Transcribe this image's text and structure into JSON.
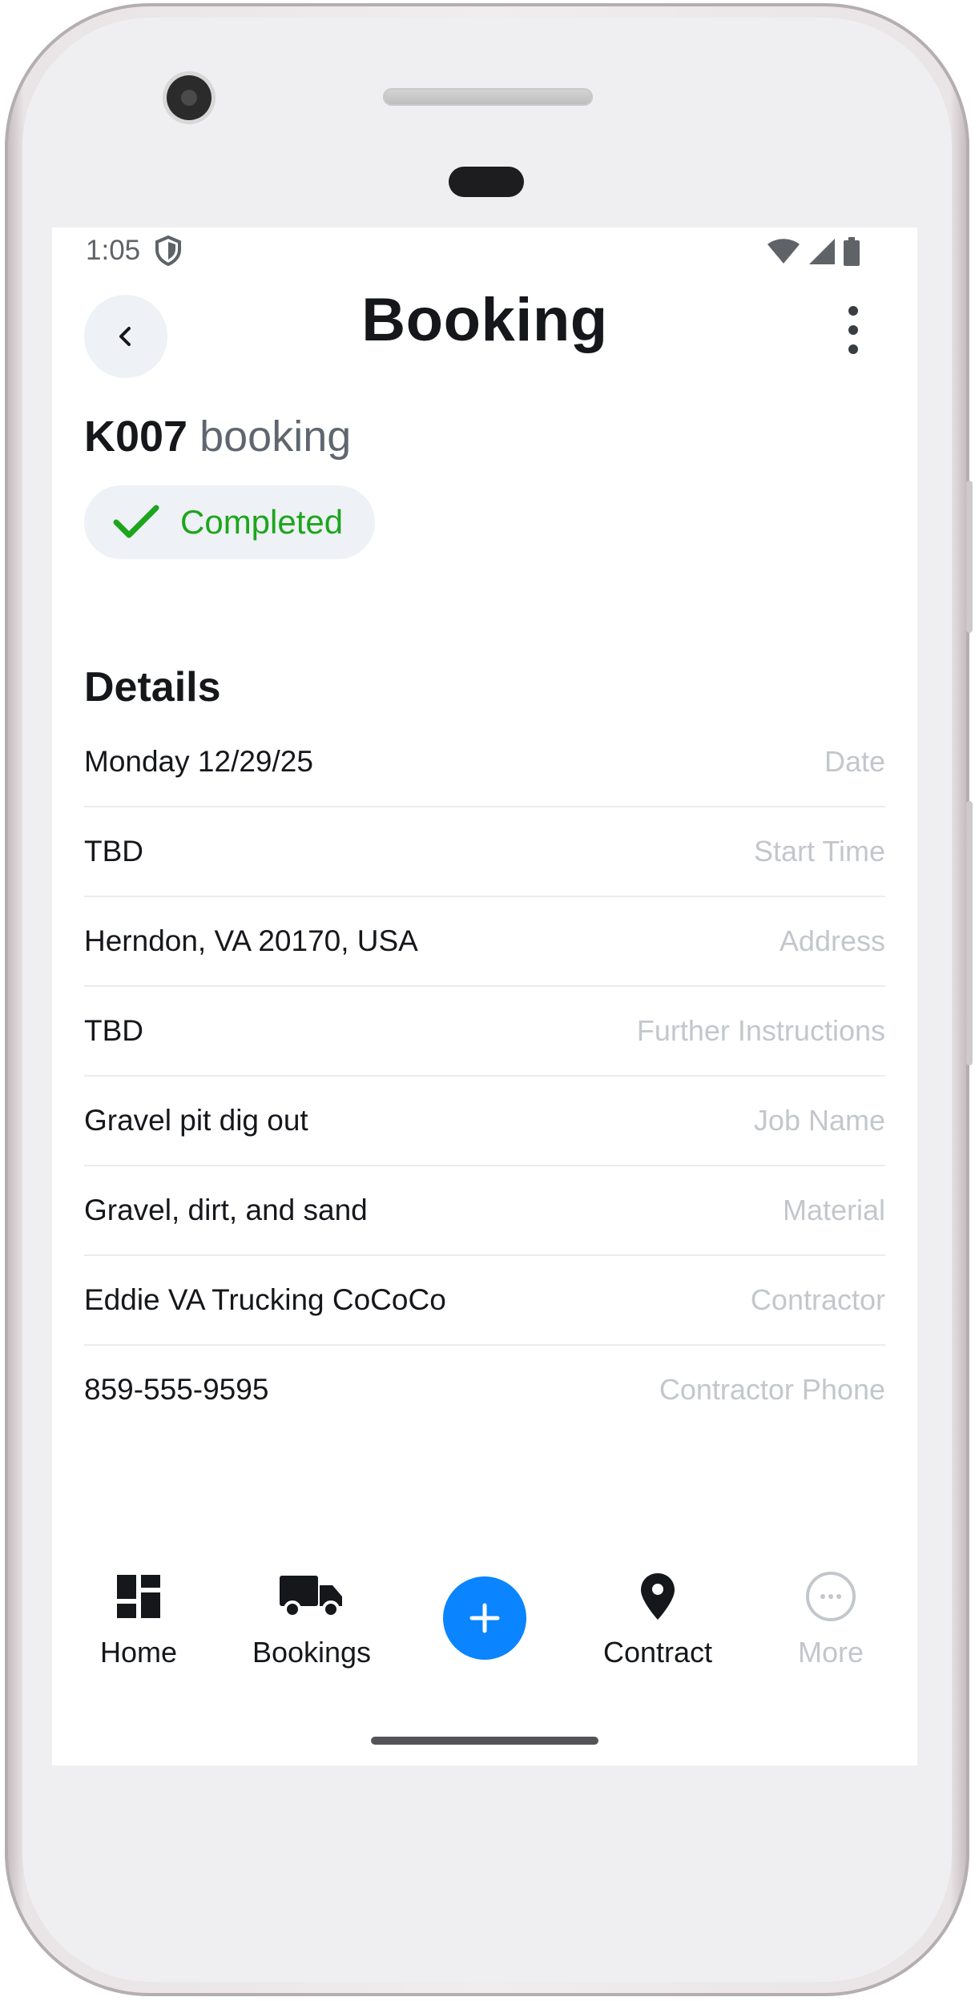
{
  "status_bar": {
    "time": "1:05"
  },
  "header": {
    "title": "Booking"
  },
  "booking": {
    "code": "K007",
    "word": "booking",
    "status": "Completed"
  },
  "details": {
    "title": "Details",
    "rows": [
      {
        "value": "Monday 12/29/25",
        "label": "Date"
      },
      {
        "value": "TBD",
        "label": "Start Time"
      },
      {
        "value": "Herndon, VA 20170, USA",
        "label": "Address"
      },
      {
        "value": "TBD",
        "label": "Further Instructions"
      },
      {
        "value": "Gravel pit dig out",
        "label": "Job Name"
      },
      {
        "value": "Gravel, dirt, and sand",
        "label": "Material"
      },
      {
        "value": "Eddie VA Trucking CoCoCo",
        "label": "Contractor"
      },
      {
        "value": "859-555-9595",
        "label": "Contractor Phone"
      }
    ]
  },
  "nav": {
    "home": "Home",
    "bookings": "Bookings",
    "contract": "Contract",
    "more": "More"
  },
  "colors": {
    "accent": "#0a84ff",
    "success": "#1da51d",
    "muted": "#c3c7cc"
  }
}
